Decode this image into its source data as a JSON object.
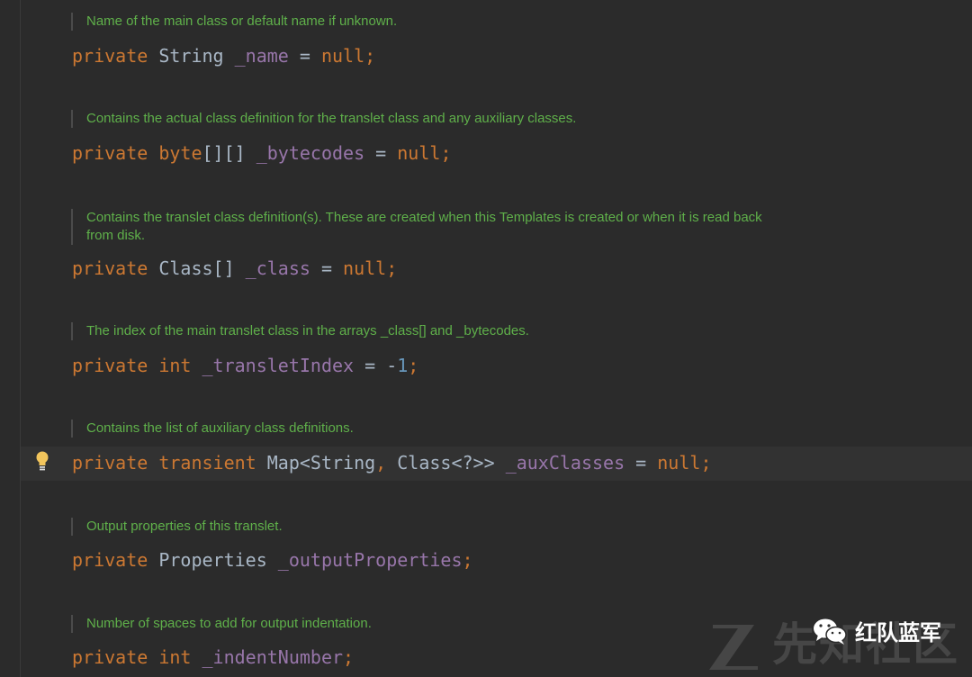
{
  "blocks": [
    {
      "doc": "Name of the main class or default name if unknown.",
      "code": [
        {
          "t": "private ",
          "c": "kw"
        },
        {
          "t": "String ",
          "c": "type"
        },
        {
          "t": "_name",
          "c": "field"
        },
        {
          "t": " = ",
          "c": "type"
        },
        {
          "t": "null",
          "c": "kw"
        },
        {
          "t": ";",
          "c": "punc"
        }
      ]
    },
    {
      "doc": "Contains the actual class definition for the translet class and any auxiliary classes.",
      "code": [
        {
          "t": "private ",
          "c": "kw"
        },
        {
          "t": "byte",
          "c": "kw"
        },
        {
          "t": "[][] ",
          "c": "type"
        },
        {
          "t": "_bytecodes",
          "c": "field"
        },
        {
          "t": " = ",
          "c": "type"
        },
        {
          "t": "null",
          "c": "kw"
        },
        {
          "t": ";",
          "c": "punc"
        }
      ]
    },
    {
      "doc": "Contains the translet class definition(s). These are created when this Templates is created or when it is read back from disk.",
      "code": [
        {
          "t": "private ",
          "c": "kw"
        },
        {
          "t": "Class[] ",
          "c": "type"
        },
        {
          "t": "_class",
          "c": "field"
        },
        {
          "t": " = ",
          "c": "type"
        },
        {
          "t": "null",
          "c": "kw"
        },
        {
          "t": ";",
          "c": "punc"
        }
      ]
    },
    {
      "doc": "The index of the main translet class in the arrays _class[] and _bytecodes.",
      "code": [
        {
          "t": "private ",
          "c": "kw"
        },
        {
          "t": "int ",
          "c": "kw"
        },
        {
          "t": "_transletIndex",
          "c": "field"
        },
        {
          "t": " = -",
          "c": "type"
        },
        {
          "t": "1",
          "c": "num"
        },
        {
          "t": ";",
          "c": "punc"
        }
      ]
    },
    {
      "doc": "Contains the list of auxiliary class definitions.",
      "code": [
        {
          "t": "private ",
          "c": "kw"
        },
        {
          "t": "transient ",
          "c": "kw"
        },
        {
          "t": "Map<String",
          "c": "type"
        },
        {
          "t": ", ",
          "c": "punc"
        },
        {
          "t": "Class<?>> ",
          "c": "type"
        },
        {
          "t": "_auxClasses",
          "c": "field"
        },
        {
          "t": " = ",
          "c": "type"
        },
        {
          "t": "null",
          "c": "kw"
        },
        {
          "t": ";",
          "c": "punc"
        }
      ]
    },
    {
      "doc": "Output properties of this translet.",
      "code": [
        {
          "t": "private ",
          "c": "kw"
        },
        {
          "t": "Properties ",
          "c": "type"
        },
        {
          "t": "_outputProperties",
          "c": "field"
        },
        {
          "t": ";",
          "c": "punc"
        }
      ]
    },
    {
      "doc": "Number of spaces to add for output indentation.",
      "code": [
        {
          "t": "private ",
          "c": "kw"
        },
        {
          "t": "int ",
          "c": "kw"
        },
        {
          "t": "_indentNumber",
          "c": "field"
        },
        {
          "t": ";",
          "c": "punc"
        }
      ]
    }
  ],
  "icons": {
    "intention": "lightbulb-icon",
    "wechat": "wechat-icon",
    "brand": "xz-logo-icon"
  },
  "watermark": {
    "account": "红队蓝军",
    "site": "先知社区"
  },
  "colors": {
    "background": "#2b2b2b",
    "keyword": "#cc7832",
    "field": "#9876aa",
    "number": "#6897bb",
    "default": "#a9b7c6",
    "doc": "#5fb04a"
  }
}
